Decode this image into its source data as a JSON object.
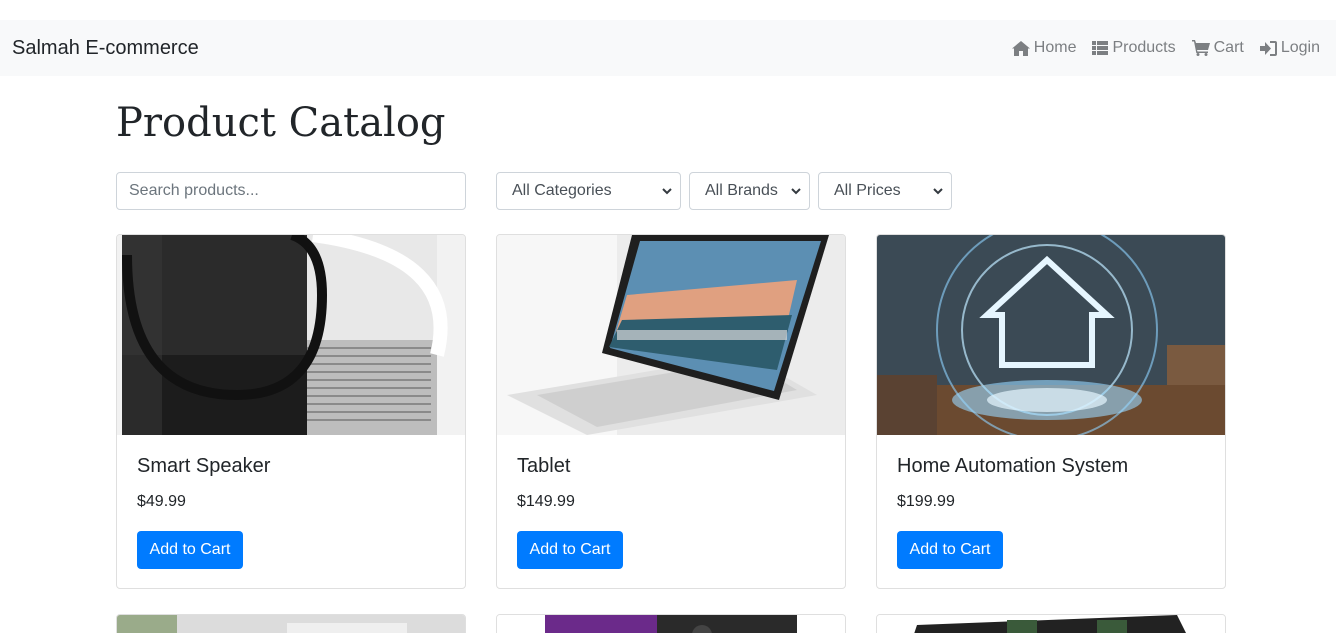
{
  "navbar": {
    "brand": "Salmah E-commerce",
    "links": [
      {
        "label": "Home",
        "icon": "home-icon"
      },
      {
        "label": "Products",
        "icon": "list-icon"
      },
      {
        "label": "Cart",
        "icon": "cart-icon"
      },
      {
        "label": "Login",
        "icon": "login-icon"
      }
    ]
  },
  "main": {
    "title": "Product Catalog",
    "search": {
      "placeholder": "Search products...",
      "value": ""
    },
    "filters": {
      "category": "All Categories",
      "brand": "All Brands",
      "price": "All Prices"
    },
    "products": [
      {
        "name": "Smart Speaker",
        "price": "$49.99",
        "button": "Add to Cart"
      },
      {
        "name": "Tablet",
        "price": "$149.99",
        "button": "Add to Cart"
      },
      {
        "name": "Home Automation System",
        "price": "$199.99",
        "button": "Add to Cart"
      }
    ]
  },
  "colors": {
    "navbar_bg": "#f8f9fa",
    "primary_button": "#007bff",
    "nav_link": "#7c7f82"
  }
}
